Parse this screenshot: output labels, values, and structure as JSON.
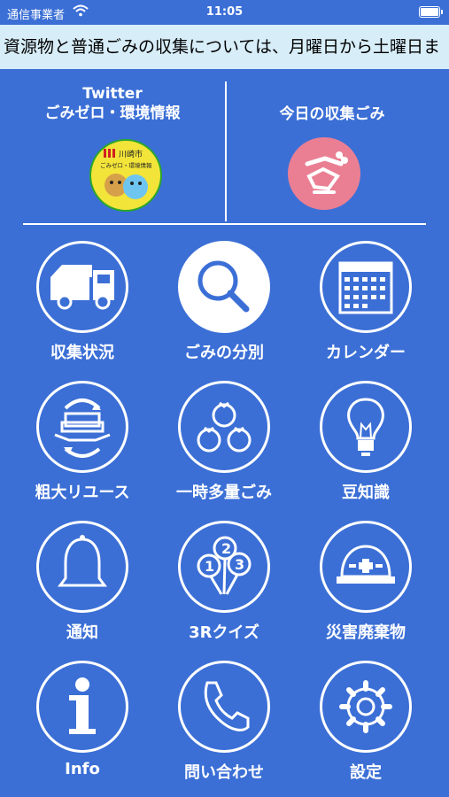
{
  "status_bar": {
    "carrier": "通信事業者",
    "time": "11:05"
  },
  "ticker": {
    "text": "資源物と普通ごみの収集については、月曜日から土曜日ま"
  },
  "twitter_panel": {
    "title_line1": "Twitter",
    "title_line2": "ごみゼロ・環境情報",
    "badge_text_city": "川崎市",
    "badge_text_sub": "ごみゼロ・環境情報"
  },
  "today_panel": {
    "title": "今日の収集ごみ"
  },
  "menu": {
    "items": [
      {
        "label": "収集状況",
        "icon": "truck-icon"
      },
      {
        "label": "ごみの分別",
        "icon": "magnifier-icon"
      },
      {
        "label": "カレンダー",
        "icon": "calendar-icon"
      },
      {
        "label": "粗大リユース",
        "icon": "reuse-sofa-icon"
      },
      {
        "label": "一時多量ごみ",
        "icon": "garbage-bags-icon"
      },
      {
        "label": "豆知識",
        "icon": "lightbulb-icon"
      },
      {
        "label": "通知",
        "icon": "bell-icon"
      },
      {
        "label": "3Rクイズ",
        "icon": "quiz-balloons-icon"
      },
      {
        "label": "災害廃棄物",
        "icon": "helmet-icon"
      },
      {
        "label": "Info",
        "icon": "info-icon"
      },
      {
        "label": "問い合わせ",
        "icon": "phone-icon"
      },
      {
        "label": "設定",
        "icon": "gear-icon"
      }
    ]
  },
  "colors": {
    "background": "#3b6fd6",
    "ticker_bg": "#d7edf8",
    "today_badge": "#ea7f93",
    "twitter_badge": "#f3e43a"
  }
}
